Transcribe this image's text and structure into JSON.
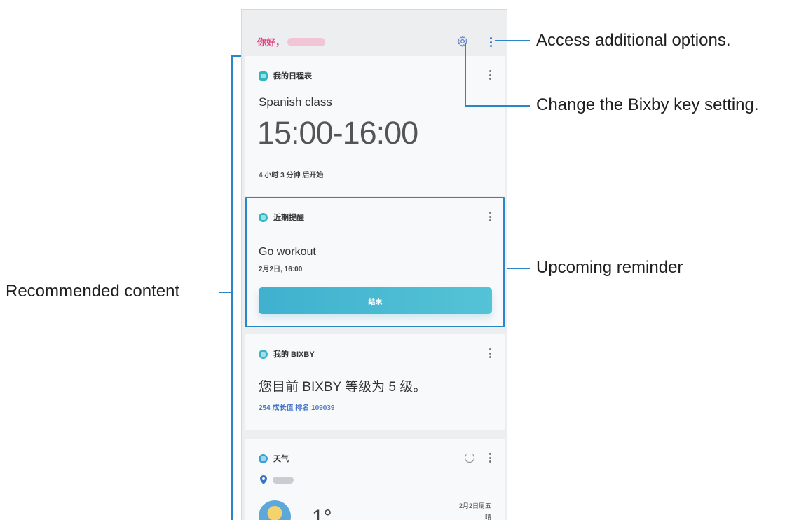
{
  "greeting": {
    "text": "你好，"
  },
  "schedule_card": {
    "header": "我的日程表",
    "title": "Spanish class",
    "time": "15:00-16:00",
    "subtitle": "4 小时 3 分钟 后开始",
    "icon_color": "#2fb6c0"
  },
  "reminder_card": {
    "header": "近期提醒",
    "title": "Go workout",
    "subtitle": "2月2日, 16:00",
    "button_label": "结束",
    "icon_color": "#2fb6c0"
  },
  "bixby_card": {
    "header": "我的 BIXBY",
    "title": "您目前 BIXBY 等级为 5 级。",
    "subtitle": "254 成长值   排名 109039",
    "icon_color": "#3ab4c8"
  },
  "weather_card": {
    "header": "天气",
    "temperature": "1°",
    "date": "2月2日周五",
    "condition": "晴",
    "icon_color": "#3aa0d8"
  },
  "annotations": {
    "options": "Access additional options.",
    "bixby_key": "Change the Bixby key setting.",
    "reminder": "Upcoming reminder",
    "recommended": "Recommended content"
  },
  "colors": {
    "accent_pink": "#e1407d",
    "callout_blue": "#2b86c5",
    "button_teal": "#44b6d1"
  }
}
